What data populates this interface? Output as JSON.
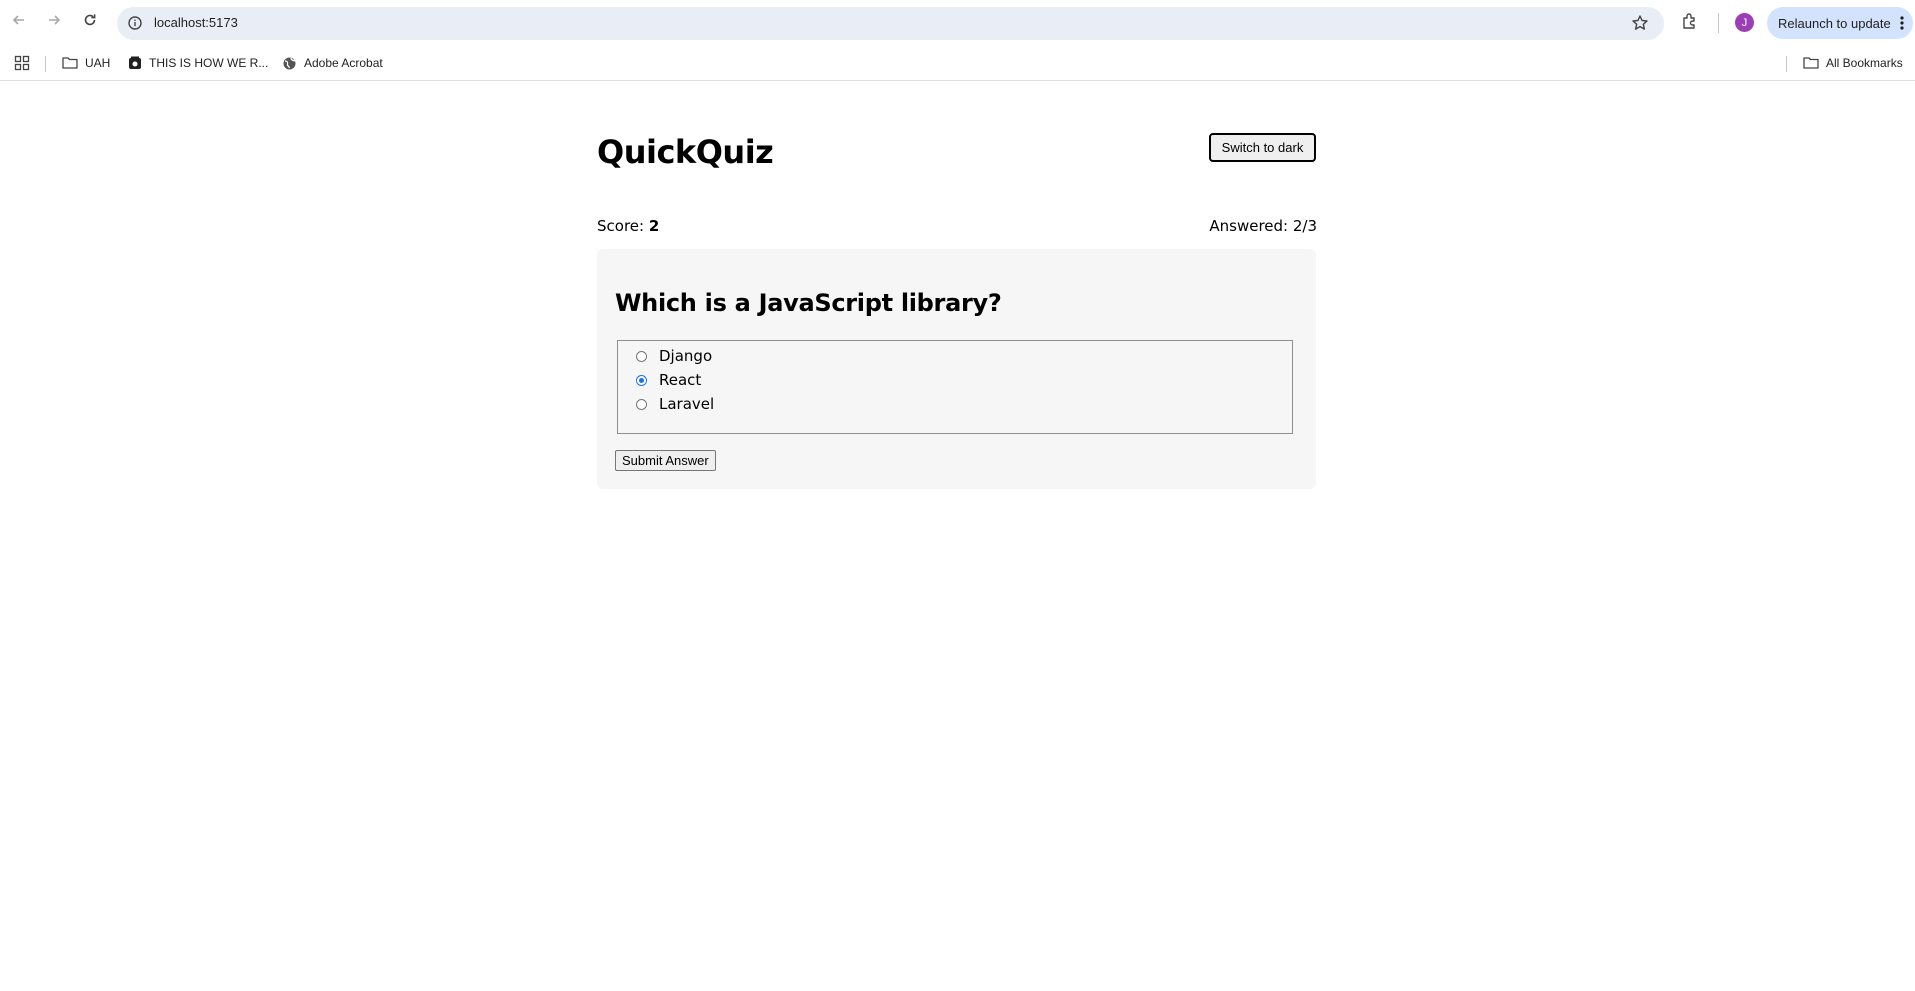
{
  "browser": {
    "url": "localhost:5173",
    "relaunch_label": "Relaunch to update",
    "avatar_initial": "J",
    "avatar_color": "#9c3fb7",
    "bookmarks": [
      {
        "label": "UAH",
        "icon": "folder-icon"
      },
      {
        "label": "THIS IS HOW WE R...",
        "icon": "site-favicon-icon"
      },
      {
        "label": "Adobe Acrobat",
        "icon": "globe-icon"
      }
    ],
    "all_bookmarks_label": "All Bookmarks"
  },
  "app": {
    "title": "QuickQuiz",
    "theme_toggle_label": "Switch to dark",
    "score_label": "Score:",
    "score_value": "2",
    "answered_text": "Answered: 2/3",
    "question": "Which is a JavaScript library?",
    "options": [
      {
        "label": "Django",
        "selected": false
      },
      {
        "label": "React",
        "selected": true
      },
      {
        "label": "Laravel",
        "selected": false
      }
    ],
    "submit_label": "Submit Answer",
    "accent_color": "#1a73e8"
  }
}
